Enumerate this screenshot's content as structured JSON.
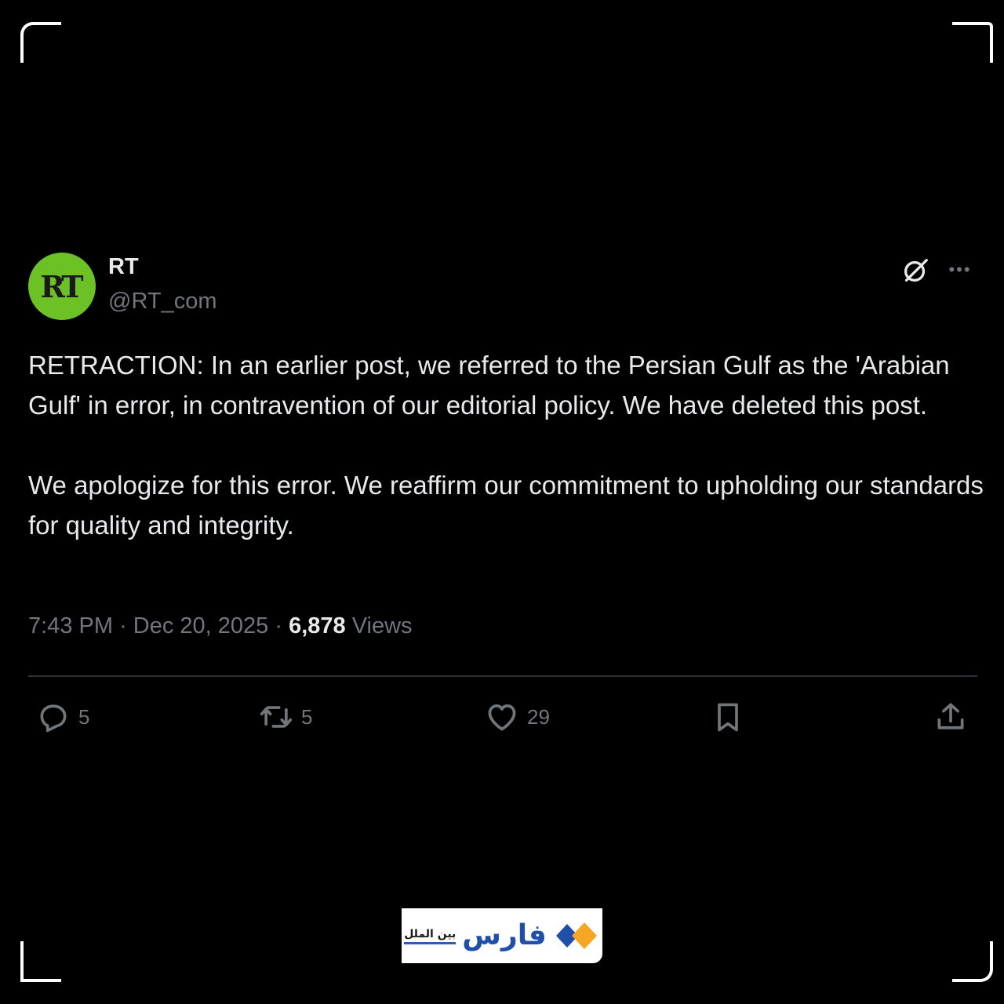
{
  "account": {
    "avatar_text": "RT",
    "avatar_color": "#6cc224",
    "name": "RT",
    "handle": "@RT_com"
  },
  "header_icons": [
    "grok-icon",
    "more-icon"
  ],
  "post": {
    "paragraphs": [
      "RETRACTION: In an earlier post, we referred to the Persian Gulf as the 'Arabian Gulf' in error, in contravention of our editorial policy. We have deleted this post.",
      "We apologize for this error. We reaffirm our commitment to upholding our standards for quality and integrity."
    ],
    "time": "7:43 PM",
    "date": "Dec 20, 2025",
    "views_count": "6,878",
    "views_label": "Views"
  },
  "actions": {
    "replies": "5",
    "reposts": "5",
    "likes": "29"
  },
  "watermark": {
    "name": "فارس",
    "subtitle": "بین الملل"
  },
  "colors": {
    "background": "#000000",
    "text": "#e7e9ea",
    "muted": "#71767b",
    "logo_blue": "#1f4fa8",
    "logo_orange": "#f5a623"
  }
}
